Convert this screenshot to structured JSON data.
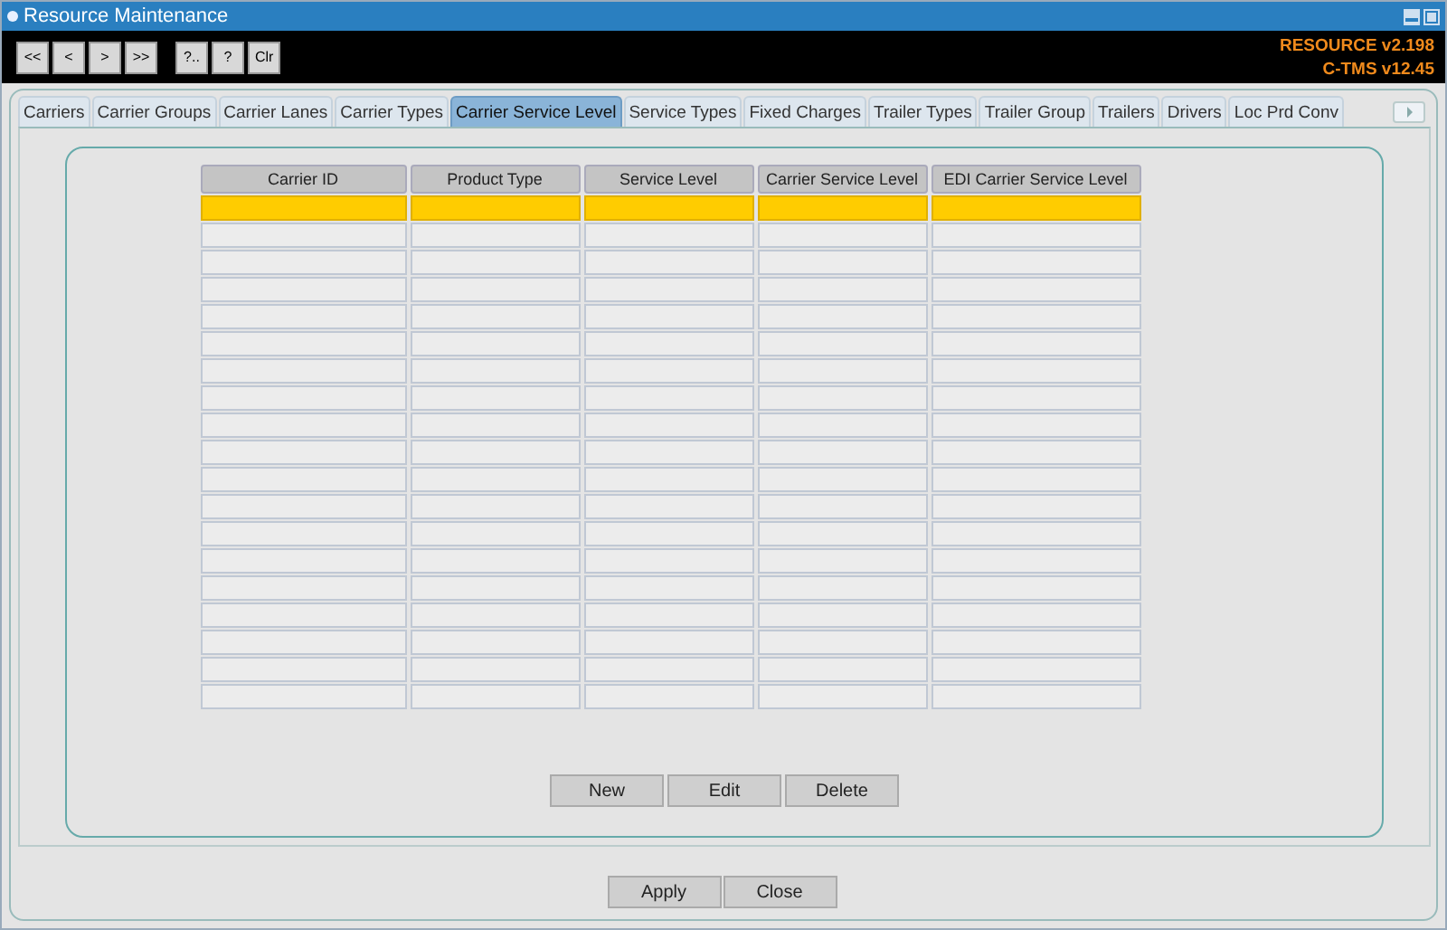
{
  "window": {
    "title": "Resource Maintenance"
  },
  "toolbar": {
    "buttons": [
      "<<",
      "<",
      ">",
      ">>",
      "?..",
      "?",
      "Clr"
    ],
    "versions": [
      "RESOURCE v2.198",
      "C-TMS v12.45"
    ]
  },
  "tabs": [
    {
      "label": "Carriers",
      "selected": false
    },
    {
      "label": "Carrier Groups",
      "selected": false
    },
    {
      "label": "Carrier Lanes",
      "selected": false
    },
    {
      "label": "Carrier Types",
      "selected": false
    },
    {
      "label": "Carrier Service Level",
      "selected": true
    },
    {
      "label": "Service Types",
      "selected": false
    },
    {
      "label": "Fixed Charges",
      "selected": false
    },
    {
      "label": "Trailer Types",
      "selected": false
    },
    {
      "label": "Trailer Group",
      "selected": false
    },
    {
      "label": "Trailers",
      "selected": false
    },
    {
      "label": "Drivers",
      "selected": false
    },
    {
      "label": "Loc Prd Conv",
      "selected": false
    }
  ],
  "table": {
    "columns": [
      "Carrier ID",
      "Product Type",
      "Service Level",
      "Carrier Service Level",
      "EDI Carrier Service Level"
    ],
    "rows": [
      {
        "selected": true
      },
      {
        "selected": false
      },
      {
        "selected": false
      },
      {
        "selected": false
      },
      {
        "selected": false
      },
      {
        "selected": false
      },
      {
        "selected": false
      },
      {
        "selected": false
      },
      {
        "selected": false
      },
      {
        "selected": false
      },
      {
        "selected": false
      },
      {
        "selected": false
      },
      {
        "selected": false
      },
      {
        "selected": false
      },
      {
        "selected": false
      },
      {
        "selected": false
      },
      {
        "selected": false
      },
      {
        "selected": false
      },
      {
        "selected": false
      }
    ]
  },
  "panel_buttons": [
    "New",
    "Edit",
    "Delete"
  ],
  "footer_buttons": [
    "Apply",
    "Close"
  ]
}
